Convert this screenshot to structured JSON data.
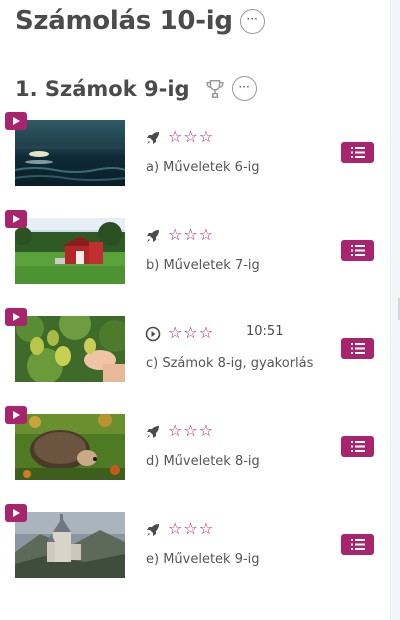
{
  "page": {
    "title": "Számolás 10-ig",
    "more_label": "···"
  },
  "section": {
    "title": "1. Számok 9-ig",
    "more_label": "···"
  },
  "lessons": [
    {
      "name": "a) Műveletek 6-ig",
      "stars": "☆☆☆",
      "type": "rocket",
      "duration": "",
      "image": "lake at sunrise"
    },
    {
      "name": "b) Műveletek 7-ig",
      "stars": "☆☆☆",
      "type": "rocket",
      "duration": "",
      "image": "red barn"
    },
    {
      "name": "c) Számok 8-ig, gyakorlás",
      "stars": "☆☆☆",
      "type": "play-circle",
      "duration": "10:51",
      "image": "pears on tree"
    },
    {
      "name": "d) Műveletek 8-ig",
      "stars": "☆☆☆",
      "type": "rocket",
      "duration": "",
      "image": "hedgehog"
    },
    {
      "name": "e) Műveletek 9-ig",
      "stars": "☆☆☆",
      "type": "rocket",
      "duration": "",
      "image": "castle"
    }
  ],
  "colors": {
    "accent": "#a8246d",
    "text": "#4b4b4b"
  }
}
